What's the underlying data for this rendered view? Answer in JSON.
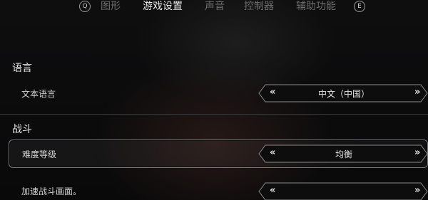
{
  "tabbar": {
    "left_key": "Q",
    "right_key": "E",
    "tabs": [
      {
        "label": "图形",
        "active": false
      },
      {
        "label": "游戏设置",
        "active": true
      },
      {
        "label": "声音",
        "active": false
      },
      {
        "label": "控制器",
        "active": false
      },
      {
        "label": "辅助功能",
        "active": false
      }
    ]
  },
  "sections": {
    "language": {
      "title": "语言",
      "text_language": {
        "label": "文本语言",
        "value": "中文（中国）"
      }
    },
    "combat": {
      "title": "战斗",
      "difficulty": {
        "label": "难度等级",
        "value": "均衡"
      },
      "speed_up": {
        "label": "加速战斗画面。",
        "value": ""
      }
    }
  },
  "icons": {
    "prev": "«",
    "next": "»"
  },
  "colors": {
    "background": "#0b0b0c",
    "active_tab": "#e8e8e8",
    "inactive_tab": "#6d6d6d",
    "selected_border": "#7a7a7a"
  }
}
